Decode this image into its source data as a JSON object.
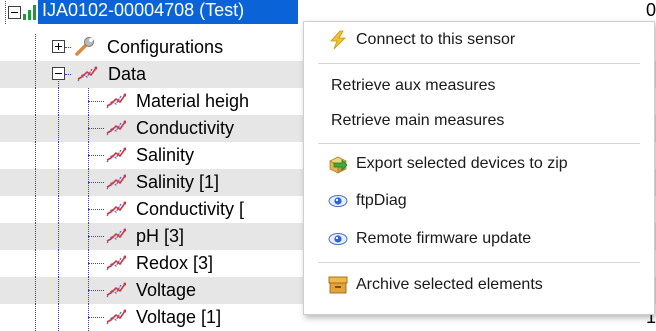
{
  "tree": {
    "root": {
      "label": "IJA0102-00004708 (Test)",
      "trailing_value": "0"
    },
    "nodes": [
      {
        "label": "Configurations",
        "icon": "wrench-icon",
        "expander": "plus"
      },
      {
        "label": "Data",
        "icon": "chart-icon",
        "expander": "minus"
      },
      {
        "label": "Material heigh",
        "icon": "chart-icon"
      },
      {
        "label": "Conductivity",
        "icon": "chart-icon"
      },
      {
        "label": "Salinity",
        "icon": "chart-icon"
      },
      {
        "label": "Salinity [1]",
        "icon": "chart-icon"
      },
      {
        "label": "Conductivity [",
        "icon": "chart-icon"
      },
      {
        "label": "pH [3]",
        "icon": "chart-icon"
      },
      {
        "label": "Redox [3]",
        "icon": "chart-icon"
      },
      {
        "label": "Voltage",
        "icon": "chart-icon"
      },
      {
        "label": "Voltage [1]",
        "icon": "chart-icon",
        "trailing_value": "1"
      }
    ]
  },
  "context_menu": {
    "connect": "Connect to this sensor",
    "retrieve_aux": "Retrieve aux measures",
    "retrieve_main": "Retrieve main measures",
    "export_zip": "Export selected devices to zip",
    "ftpdiag": "ftpDiag",
    "firmware": "Remote firmware update",
    "archive": "Archive selected elements"
  },
  "colors": {
    "selection": "#0a64d8",
    "tree_line": "#3a3ad0",
    "alt_row": "#e6e6e6"
  }
}
